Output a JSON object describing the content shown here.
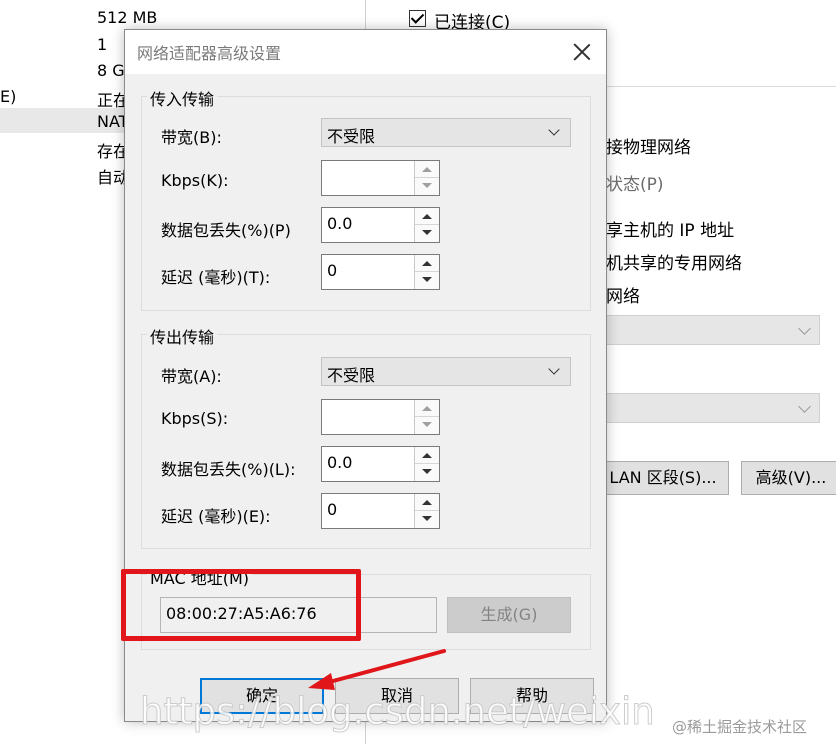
{
  "background": {
    "left_values": [
      "512 MB",
      "1",
      "8 G",
      "正在",
      "NAT",
      "存在",
      "自动"
    ],
    "left_edge_label": "E)",
    "connected_label": "已连接(C)",
    "right_texts": [
      "接物理网络",
      "状态(P)",
      "享主机的 IP 地址",
      "机共享的专用网络",
      "网络"
    ],
    "lan_button": "LAN 区段(S)...",
    "advanced_button": "高级(V)..."
  },
  "dialog": {
    "title": "网络适配器高级设置",
    "incoming": {
      "group_label": "传入传输",
      "bandwidth_label": "带宽(B):",
      "bandwidth_value": "不受限",
      "kbps_label": "Kbps(K):",
      "kbps_value": "",
      "loss_label": "数据包丢失(%)(P)",
      "loss_value": "0.0",
      "latency_label": "延迟 (毫秒)(T):",
      "latency_value": "0"
    },
    "outgoing": {
      "group_label": "传出传输",
      "bandwidth_label": "带宽(A):",
      "bandwidth_value": "不受限",
      "kbps_label": "Kbps(S):",
      "kbps_value": "",
      "loss_label": "数据包丢失(%)(L):",
      "loss_value": "0.0",
      "latency_label": "延迟 (毫秒)(E):",
      "latency_value": "0"
    },
    "mac": {
      "group_label": "MAC 地址(M)",
      "value": "08:00:27:A5:A6:76",
      "generate_button": "生成(G)"
    },
    "buttons": {
      "ok": "确定",
      "cancel": "取消",
      "help": "帮助"
    }
  },
  "annotation": {
    "highlight_color": "#e0161a"
  },
  "watermarks": {
    "url": "https://blog.csdn.net/weixin",
    "community": "@稀土掘金技术社区"
  }
}
